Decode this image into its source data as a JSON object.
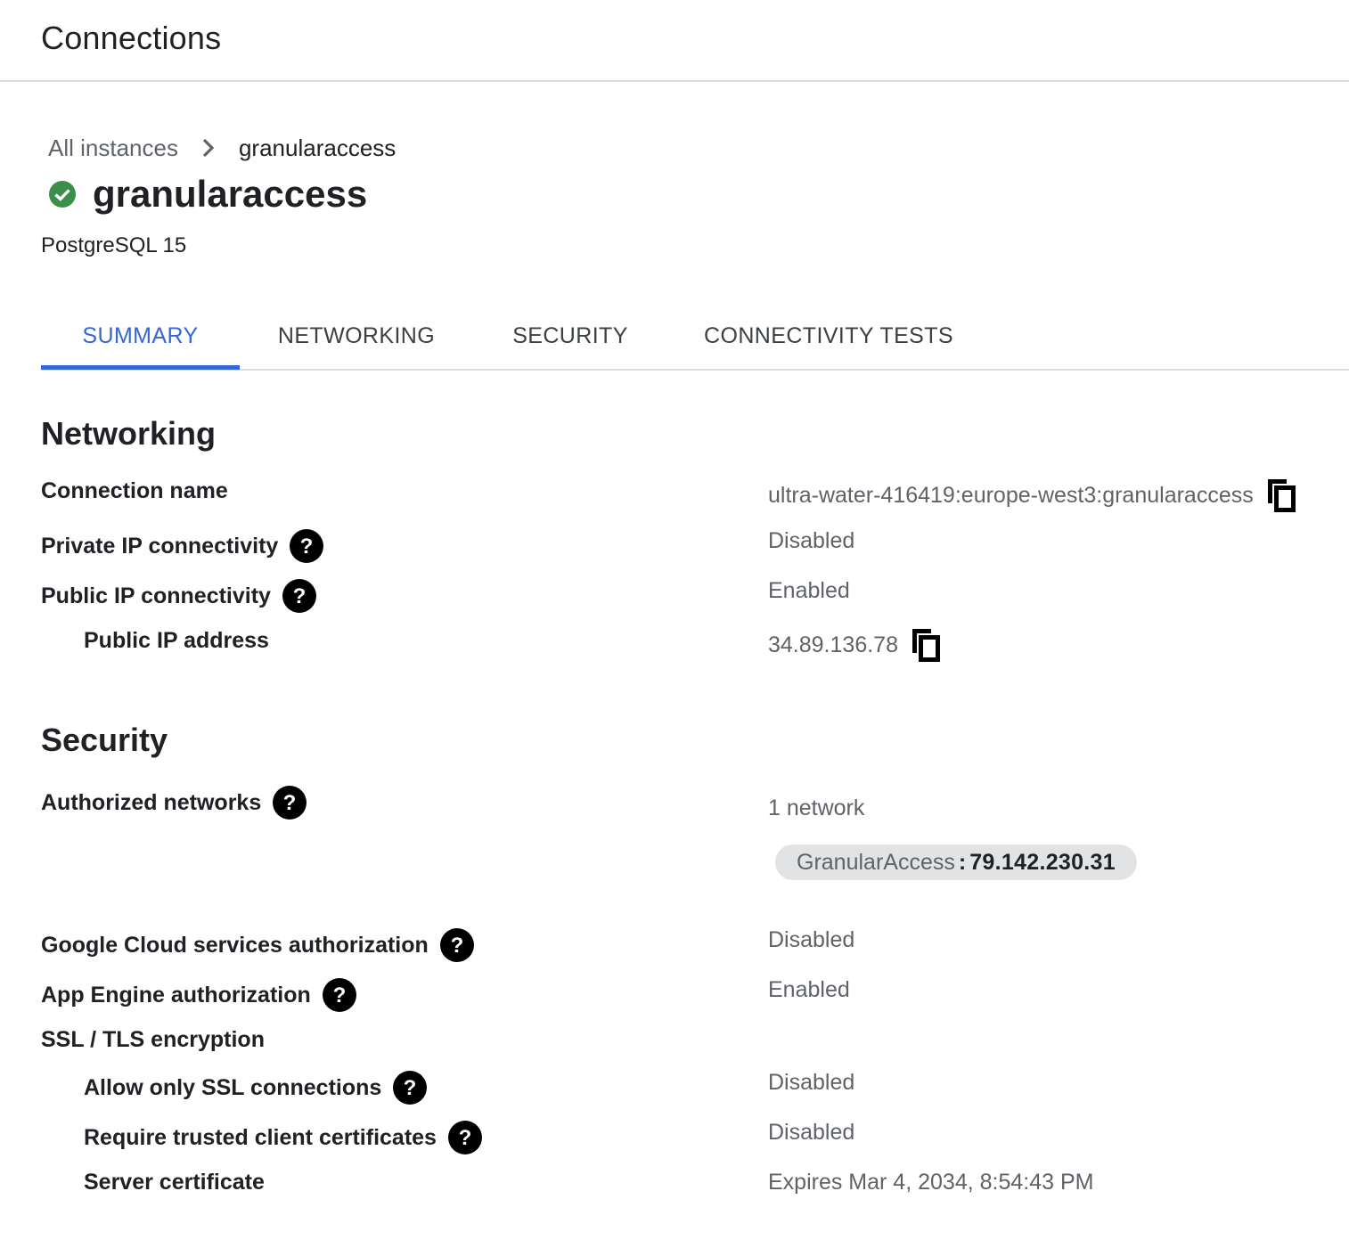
{
  "header": {
    "title": "Connections"
  },
  "breadcrumb": {
    "parent": "All instances",
    "current": "granularaccess"
  },
  "instance": {
    "name": "granularaccess",
    "version": "PostgreSQL 15",
    "status_icon": "check-circle-icon",
    "status_color": "#3c8f4a"
  },
  "tabs": [
    {
      "label": "SUMMARY",
      "active": true
    },
    {
      "label": "NETWORKING",
      "active": false
    },
    {
      "label": "SECURITY",
      "active": false
    },
    {
      "label": "CONNECTIVITY TESTS",
      "active": false
    }
  ],
  "accent_color": "#3367d6",
  "networking": {
    "title": "Networking",
    "connection_name_label": "Connection name",
    "connection_name_value": "ultra-water-416419:europe-west3:granularaccess",
    "private_ip_label": "Private IP connectivity",
    "private_ip_value": "Disabled",
    "public_ip_label": "Public IP connectivity",
    "public_ip_value": "Enabled",
    "public_ip_address_label": "Public IP address",
    "public_ip_address_value": "34.89.136.78"
  },
  "security": {
    "title": "Security",
    "authorized_networks_label": "Authorized networks",
    "authorized_networks_value": "1 network",
    "authorized_network": {
      "name": "GranularAccess",
      "separator": " : ",
      "ip": "79.142.230.31"
    },
    "gcs_auth_label": "Google Cloud services authorization",
    "gcs_auth_value": "Disabled",
    "app_engine_label": "App Engine authorization",
    "app_engine_value": "Enabled",
    "ssl_label": "SSL / TLS encryption",
    "ssl_only_label": "Allow only SSL connections",
    "ssl_only_value": "Disabled",
    "trusted_certs_label": "Require trusted client certificates",
    "trusted_certs_value": "Disabled",
    "server_cert_label": "Server certificate",
    "server_cert_value": "Expires Mar 4, 2034, 8:54:43 PM"
  }
}
